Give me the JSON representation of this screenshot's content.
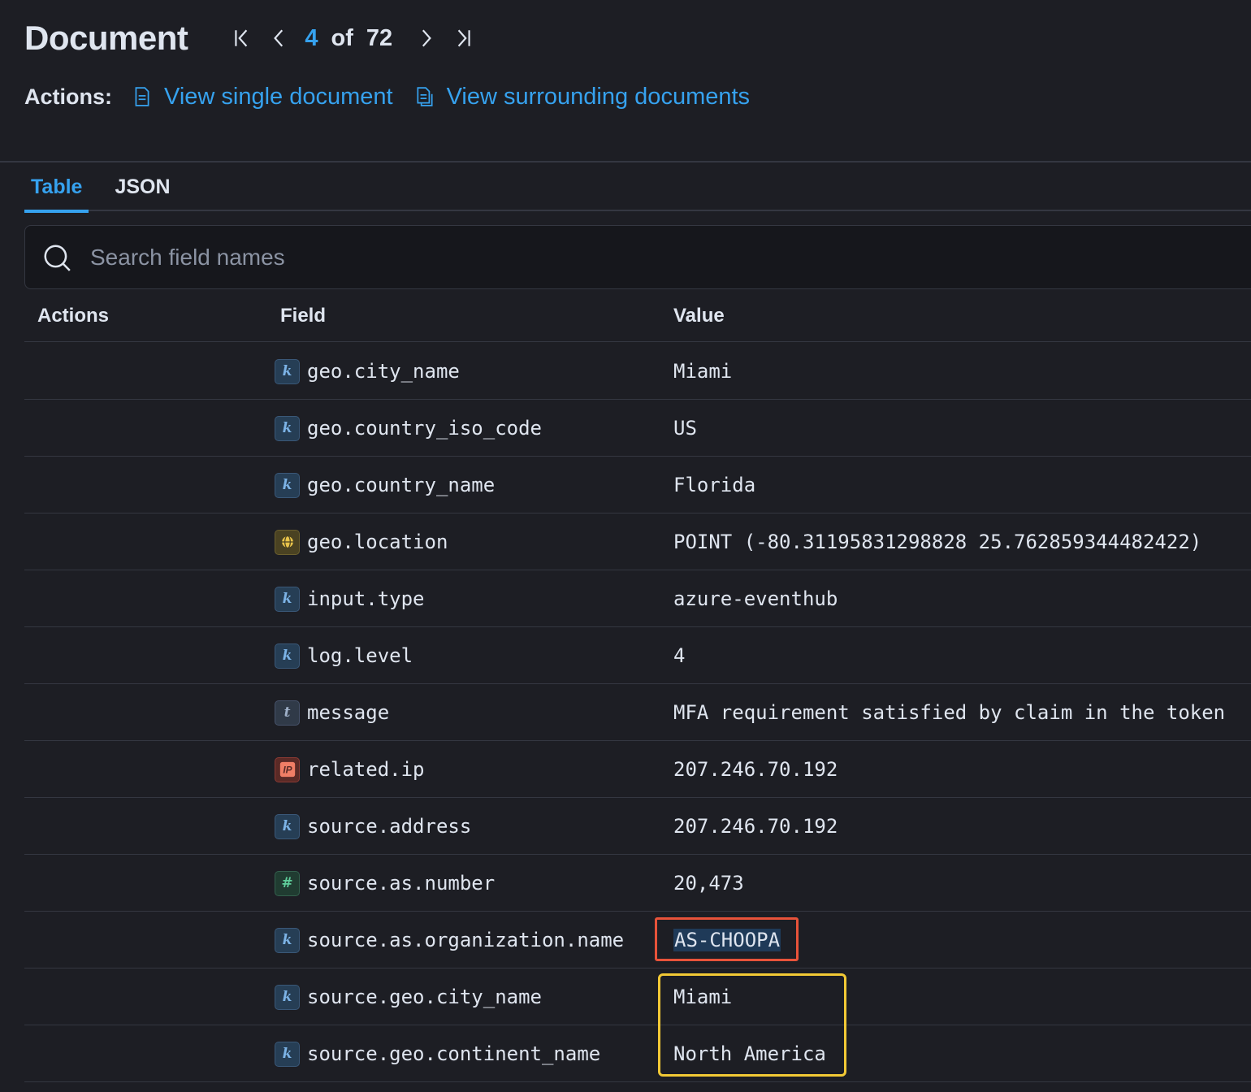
{
  "header": {
    "title": "Document",
    "pager": {
      "current": "4",
      "of": "of",
      "total": "72"
    }
  },
  "actions": {
    "label": "Actions:",
    "view_single": "View single document",
    "view_surrounding": "View surrounding documents"
  },
  "tabs": [
    {
      "label": "Table",
      "active": true
    },
    {
      "label": "JSON",
      "active": false
    }
  ],
  "search": {
    "placeholder": "Search field names",
    "value": ""
  },
  "table": {
    "columns": {
      "actions": "Actions",
      "field": "Field",
      "value": "Value"
    },
    "rows": [
      {
        "type": "k",
        "field": "geo.city_name",
        "value": "Miami"
      },
      {
        "type": "k",
        "field": "geo.country_iso_code",
        "value": "US"
      },
      {
        "type": "k",
        "field": "geo.country_name",
        "value": "Florida"
      },
      {
        "type": "geo",
        "field": "geo.location",
        "value": "POINT (-80.31195831298828 25.762859344482422)"
      },
      {
        "type": "k",
        "field": "input.type",
        "value": "azure-eventhub"
      },
      {
        "type": "k",
        "field": "log.level",
        "value": "4"
      },
      {
        "type": "t",
        "field": "message",
        "value": "MFA requirement satisfied by claim in the token"
      },
      {
        "type": "ip",
        "field": "related.ip",
        "value": "207.246.70.192"
      },
      {
        "type": "k",
        "field": "source.address",
        "value": "207.246.70.192"
      },
      {
        "type": "#",
        "field": "source.as.number",
        "value": "20,473"
      },
      {
        "type": "k",
        "field": "source.as.organization.name",
        "value": "AS-CHOOPA"
      },
      {
        "type": "k",
        "field": "source.geo.city_name",
        "value": "Miami"
      },
      {
        "type": "k",
        "field": "source.geo.continent_name",
        "value": "North America"
      }
    ]
  },
  "colors": {
    "accent": "#36a2ef",
    "background": "#1d1e24",
    "highlight_red": "#e8533a",
    "highlight_yellow": "#f2c935"
  }
}
